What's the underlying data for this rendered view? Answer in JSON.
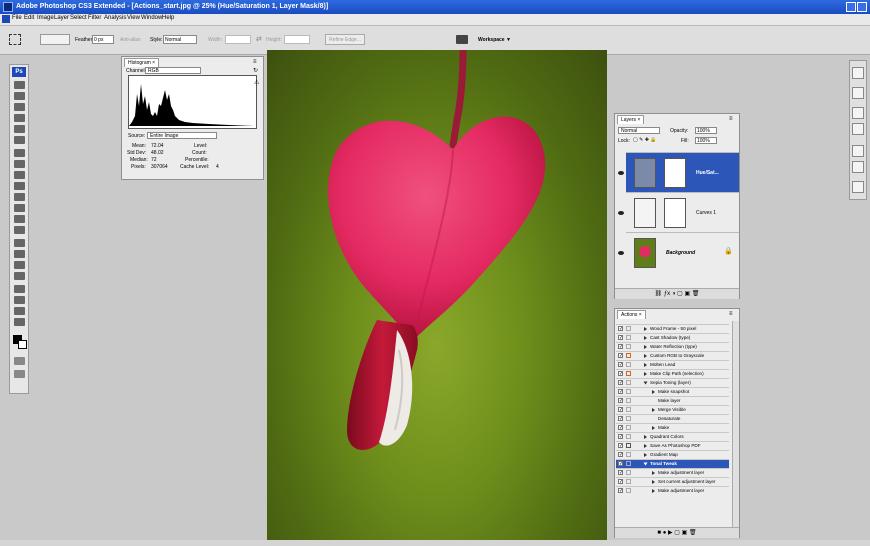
{
  "title_bar": {
    "title": "Adobe Photoshop CS3 Extended - [Actions_start.jpg @ 25% (Hue/Saturation 1, Layer Mask/8)]"
  },
  "menu": {
    "items": [
      "File",
      "Edit",
      "Image",
      "Layer",
      "Select",
      "Filter",
      "Analysis",
      "View",
      "Window",
      "Help"
    ]
  },
  "options_bar": {
    "feather_label": "Feather:",
    "feather_value": "0 px",
    "antialias_label": "Anti-alias",
    "style_label": "Style:",
    "style_value": "Normal",
    "width_label": "Width:",
    "height_label": "Height:",
    "refine_edge_label": "Refine Edge...",
    "workspace_label": "Workspace ▼"
  },
  "toolbox": {
    "logo": "Ps"
  },
  "histogram": {
    "tab": "Histogram ×",
    "channel_label": "Channel:",
    "channel_value": "RGB",
    "source_label": "Source:",
    "source_value": "Entire Image",
    "mean_label": "Mean:",
    "mean_value": "72.04",
    "stddev_label": "Std Dev:",
    "stddev_value": "48.02",
    "median_label": "Median:",
    "median_value": "72",
    "pixels_label": "Pixels:",
    "pixels_value": "307064",
    "level_label": "Level:",
    "count_label": "Count:",
    "percentile_label": "Percentile:",
    "cache_label": "Cache Level:",
    "cache_value": "4"
  },
  "layers": {
    "tab": "Layers ×",
    "blend_mode": "Normal",
    "opacity_label": "Opacity:",
    "opacity_value": "100%",
    "lock_label": "Lock:",
    "fill_label": "Fill:",
    "fill_value": "100%",
    "items": [
      {
        "name": "Hue/Sat..."
      },
      {
        "name": "Curves 1"
      },
      {
        "name": "Background"
      }
    ]
  },
  "actions": {
    "tab": "Actions ×",
    "items": [
      {
        "label": "Wood Frame - 50 pixel"
      },
      {
        "label": "Cast Shadow (type)"
      },
      {
        "label": "Water Reflection (type)"
      },
      {
        "label": "Custom RGB to Grayscale"
      },
      {
        "label": "Molten Lead"
      },
      {
        "label": "Make Clip Path (selection)"
      },
      {
        "label": "Sepia Toning (layer)"
      },
      {
        "label": "Make snapshot"
      },
      {
        "label": "Make layer"
      },
      {
        "label": "Merge Visible"
      },
      {
        "label": "Desaturate"
      },
      {
        "label": "Make"
      },
      {
        "label": "Quadrant Colors"
      },
      {
        "label": "Save As Photoshop PDF"
      },
      {
        "label": "Gradient Map"
      },
      {
        "label": "Tonal Tweak"
      },
      {
        "label": "Make adjustment layer"
      },
      {
        "label": "Set current adjustment layer"
      },
      {
        "label": "Make adjustment layer"
      }
    ]
  },
  "colors": {
    "titlebar": "#1a4bc0",
    "selection": "#2c57b8",
    "heart": "#e42a62"
  }
}
